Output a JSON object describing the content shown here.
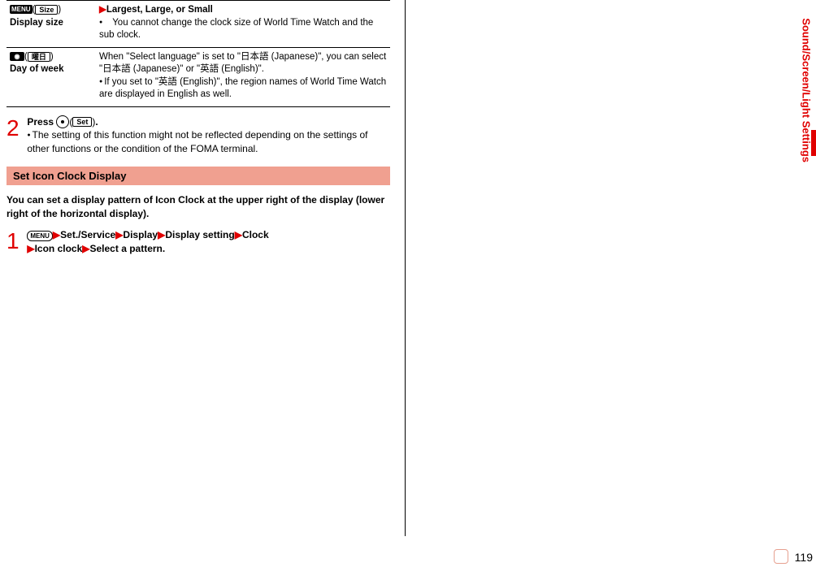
{
  "sideTab": {
    "label": "Sound/Screen/Light Settings"
  },
  "pageNumber": "119",
  "table": {
    "rows": [
      {
        "icon": "MENU",
        "uiBtn": "Size",
        "label": "Display size",
        "line1_pre": "",
        "line1_bold": "Largest, Large, or Small",
        "bullet1": "You cannot change the clock size of World Time Watch and the sub clock."
      },
      {
        "icon": "曜日",
        "uiBtn": "曜日",
        "label": "Day of week",
        "line1": "When \"Select language\" is set to \"日本語 (Japanese)\", you can select \"日本語 (Japanese)\" or \"英語 (English)\".",
        "bullet1": "If you set to \"英語 (English)\", the region names of World Time Watch are displayed in English as well."
      }
    ]
  },
  "step2": {
    "num": "2",
    "press": "Press",
    "setBtn": "Set",
    "tail": ".",
    "bullet": "The setting of this function might not be reflected depending on the settings of other functions or the condition of the FOMA terminal."
  },
  "section": {
    "title": "Set Icon Clock Display",
    "intro": "You can set a display pattern of Icon Clock at the upper right of the display (lower right of the horizontal display)."
  },
  "step1": {
    "num": "1",
    "menuKey": "MENU",
    "nav": {
      "a": "Set./Service",
      "b": "Display",
      "c": "Display setting",
      "d": "Clock",
      "e": "Icon clock",
      "f": "Select a pattern."
    }
  }
}
